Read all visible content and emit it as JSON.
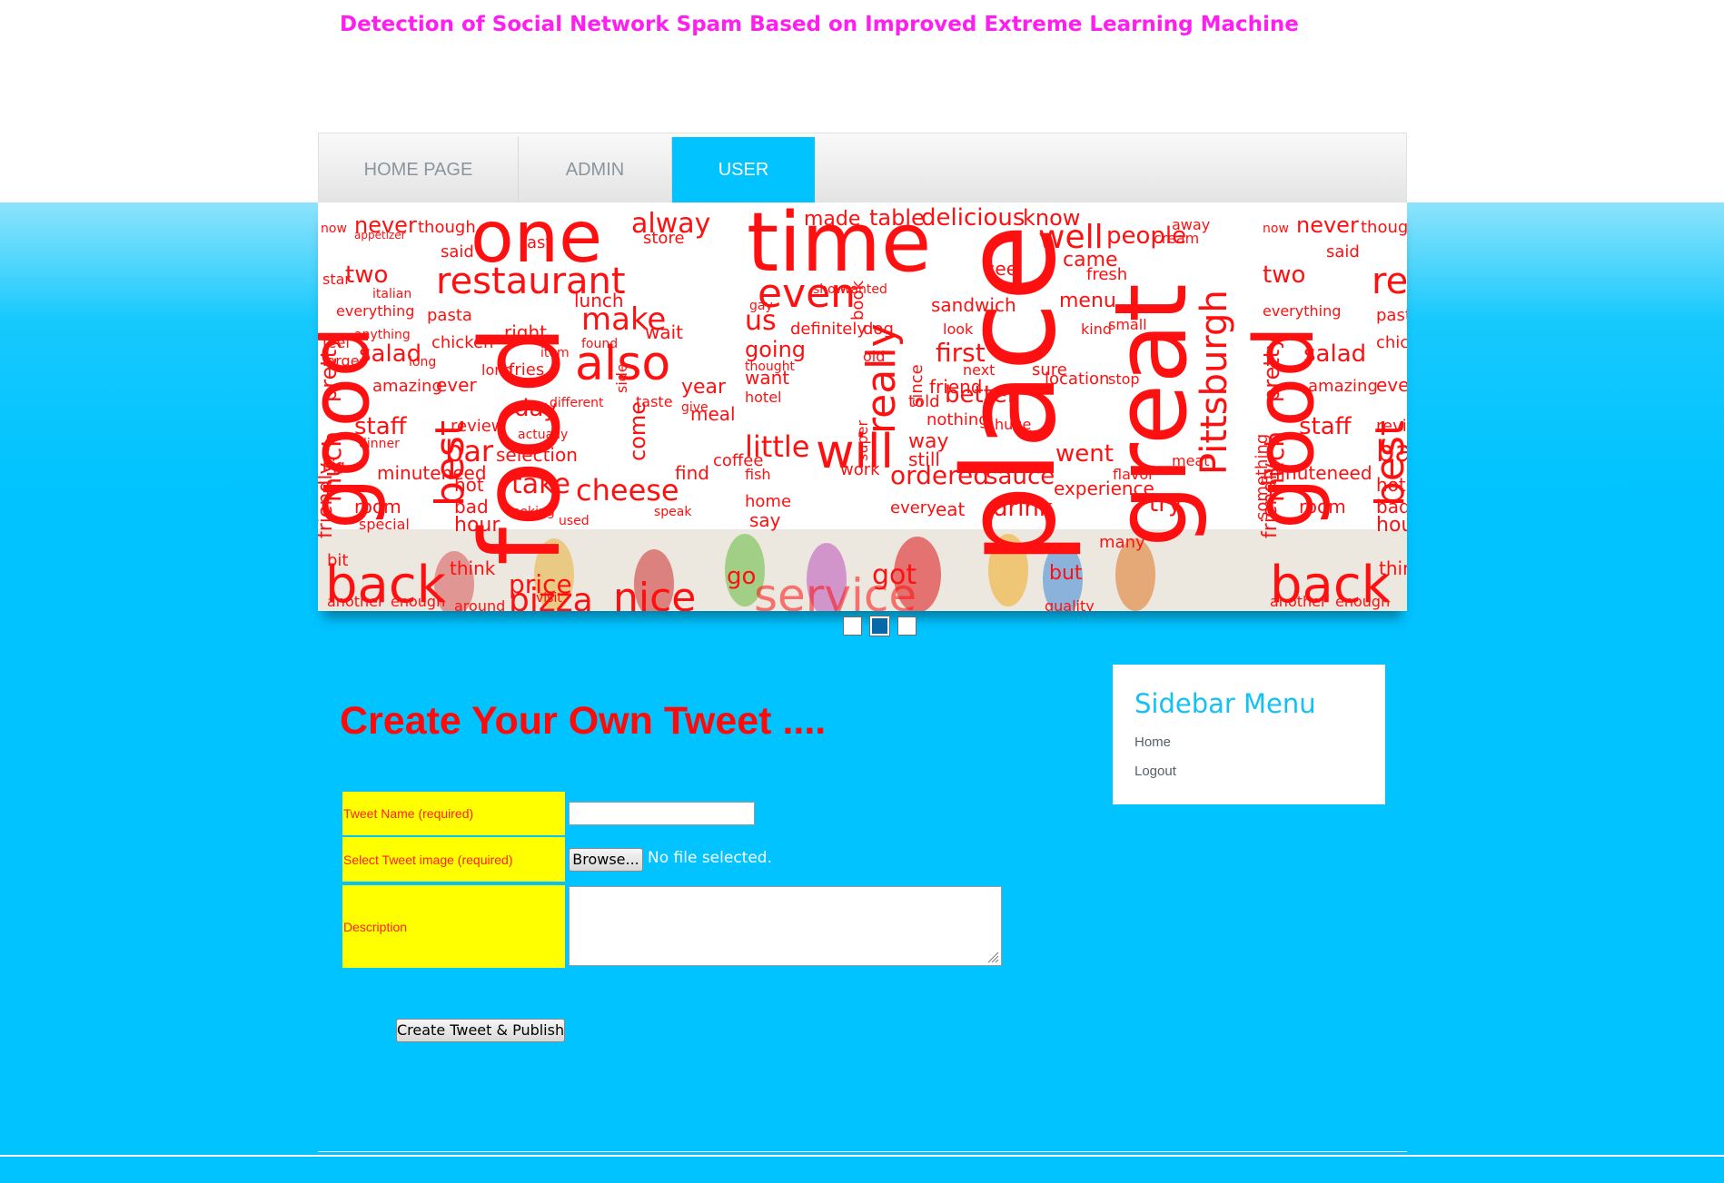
{
  "header": {
    "title": "Detection of Social Network Spam Based on Improved Extreme Learning Machine"
  },
  "nav": {
    "items": [
      {
        "label": "HOME PAGE",
        "active": false
      },
      {
        "label": "ADMIN",
        "active": false
      },
      {
        "label": "USER",
        "active": true
      }
    ]
  },
  "banner": {
    "description_words": [
      "now",
      "never",
      "though",
      "one",
      "alway",
      "time",
      "made",
      "table",
      "delicious",
      "know",
      "well",
      "people",
      "restaurant",
      "even",
      "two",
      "good",
      "pretty",
      "salad",
      "best",
      "make",
      "also",
      "really",
      "place",
      "great",
      "Pittsburgh",
      "staff",
      "bar",
      "little",
      "will",
      "ordered",
      "sauce",
      "cheese",
      "take",
      "back",
      "food",
      "pizza",
      "nice",
      "service",
      "day",
      "much",
      "friendly",
      "room",
      "first",
      "better",
      "menu",
      "fresh",
      "came",
      "try",
      "went",
      "drink",
      "eat",
      "experience",
      "go",
      "going",
      "us",
      "want",
      "hotel",
      "chicken",
      "lunch",
      "right",
      "fries",
      "year",
      "find",
      "coffee",
      "fish",
      "home",
      "say",
      "come",
      "minuteneed",
      "selection",
      "review",
      "amazing",
      "dinner",
      "special",
      "hot",
      "bad",
      "hour",
      "think",
      "another",
      "enough",
      "around",
      "price",
      "got",
      "every",
      "way",
      "still",
      "work",
      "meat",
      "flavor",
      "stop",
      "location",
      "sure",
      "next",
      "look",
      "see",
      "sandwich",
      "small",
      "kind",
      "dog",
      "definitely",
      "since",
      "friend",
      "told",
      "nothing",
      "side",
      "meal",
      "give",
      "thought",
      "old",
      "item",
      "wait",
      "long",
      "large",
      "feel",
      "italian",
      "pasta",
      "everything",
      "store",
      "last",
      "said",
      "usually",
      "big",
      "bit",
      "visit",
      "huge",
      "quality"
    ],
    "slide_indicator": {
      "count": 3,
      "active_index": 1
    }
  },
  "main": {
    "heading": "Create Your Own Tweet ....",
    "form": {
      "name_label": "Tweet Name (required)",
      "name_value": "",
      "image_label": "Select Tweet image (required)",
      "browse_label": "Browse...",
      "file_status": "No file selected.",
      "description_label": "Description",
      "description_value": "",
      "submit_label": "Create Tweet & Publish"
    }
  },
  "sidebar": {
    "title": "Sidebar Menu",
    "links": [
      "Home",
      "Logout"
    ]
  },
  "colors": {
    "accent": "#00c3ff",
    "title": "#ff1ef0",
    "heading": "#ff0a0a",
    "label_bg": "#ffff00",
    "wordcloud": "#ff1010"
  }
}
